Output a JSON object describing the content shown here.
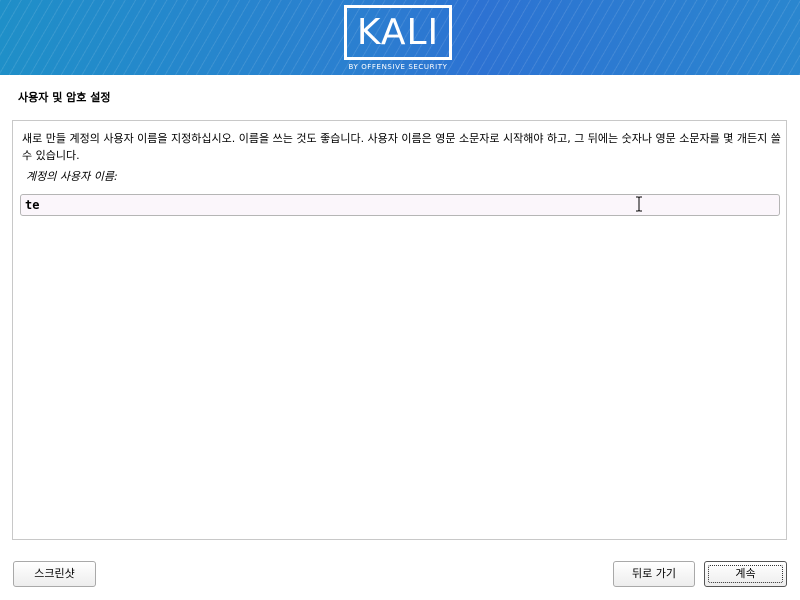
{
  "banner": {
    "logo_text": "KALI",
    "logo_subtitle": "BY OFFENSIVE SECURITY"
  },
  "page": {
    "title": "사용자 및 암호 설정",
    "description": "새로 만들 계정의 사용자 이름을 지정하십시오. 이름을 쓰는 것도 좋습니다. 사용자 이름은 영문 소문자로 시작해야 하고, 그 뒤에는 숫자나 영문 소문자를 몇 개든지 쓸 수 있습니다.",
    "field_label": "계정의 사용자 이름:",
    "username_value": "te"
  },
  "buttons": {
    "screenshot": "스크린샷",
    "back": "뒤로 가기",
    "continue": "계속"
  },
  "colors": {
    "banner_start": "#1f8fc8",
    "banner_end": "#2a86cf",
    "input_bg": "#fbf6fb"
  },
  "icons": {
    "text_cursor": "i-beam-cursor-icon"
  }
}
